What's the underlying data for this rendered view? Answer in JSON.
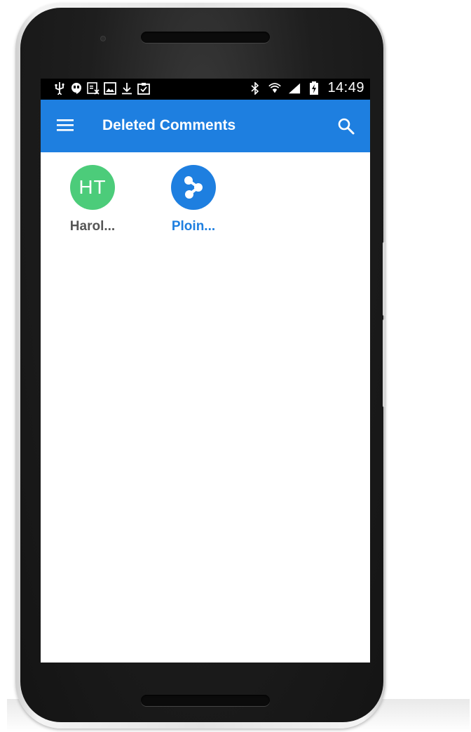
{
  "status_bar": {
    "time": "14:49",
    "left_icons": [
      "usb-icon",
      "hangouts-icon",
      "no-sim-icon",
      "image-icon",
      "download-icon",
      "clipboard-check-icon"
    ],
    "right_icons": [
      "bluetooth-icon",
      "wifi-icon",
      "signal-icon",
      "battery-charging-icon"
    ]
  },
  "app_bar": {
    "title": "Deleted Comments",
    "menu_icon": "menu-icon",
    "search_icon": "search-icon"
  },
  "colors": {
    "app_bar": "#1e7fe0",
    "status_bar": "#000000",
    "avatar_green": "#4ccc7a",
    "avatar_blue": "#1e7fe0",
    "label_dark": "#555555",
    "label_blue": "#1e7fe0"
  },
  "items": [
    {
      "initials": "HT",
      "label": "Harol...",
      "avatar_color": "#4ccc7a",
      "label_color": "#555555"
    },
    {
      "initials": "",
      "icon": "share-nodes-icon",
      "label": "Ploin...",
      "avatar_color": "#1e7fe0",
      "label_color": "#1e7fe0"
    }
  ]
}
